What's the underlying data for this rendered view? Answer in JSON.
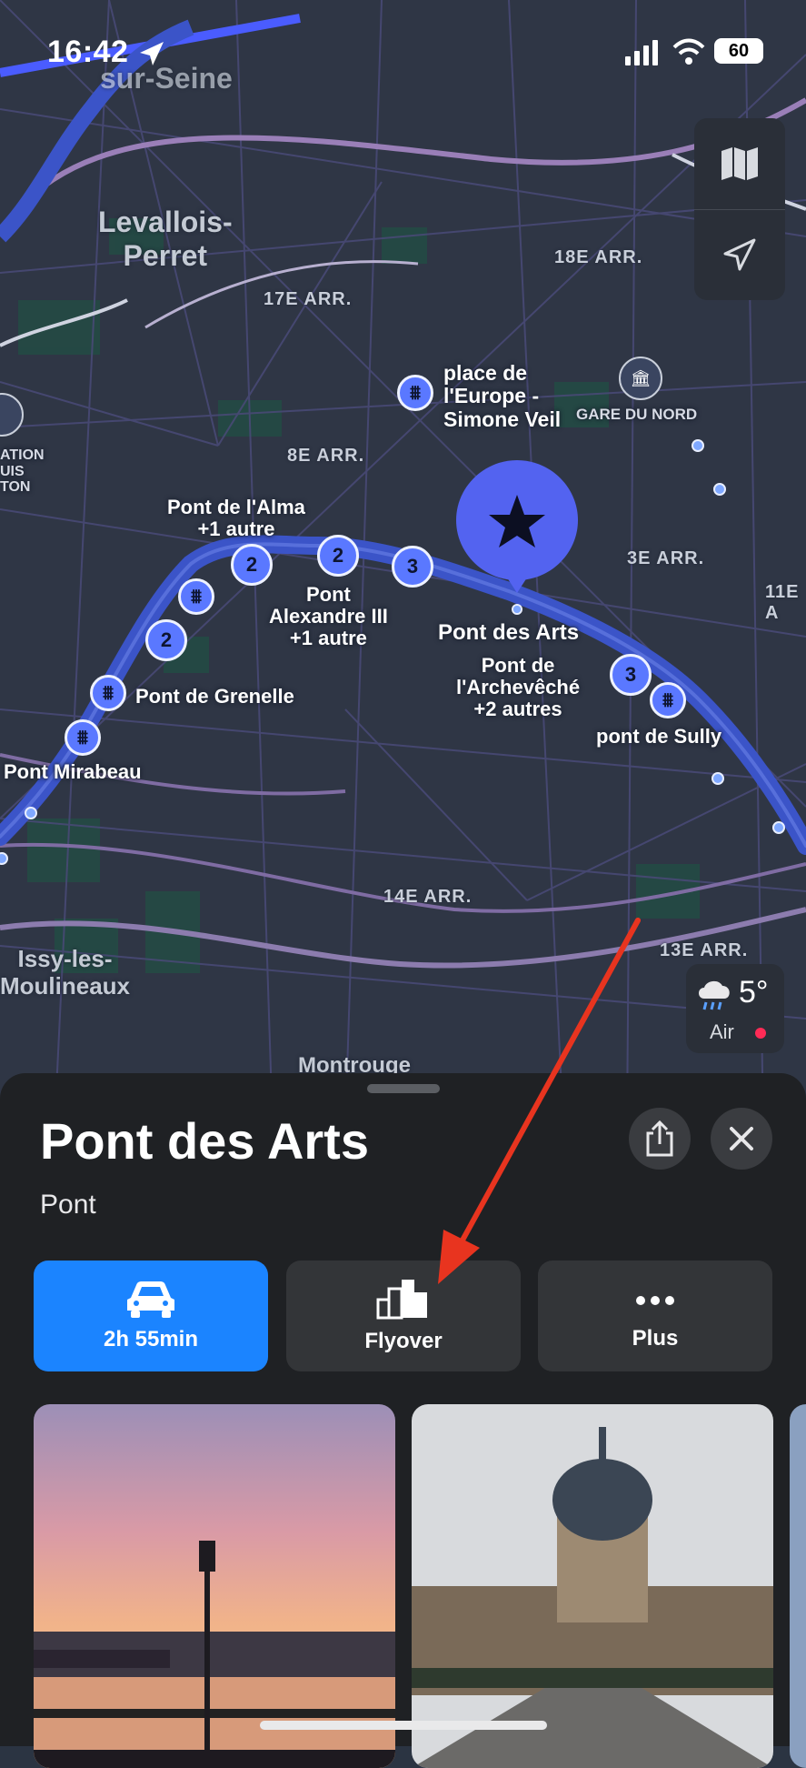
{
  "status_bar": {
    "time": "16:42",
    "battery": "60"
  },
  "map": {
    "cities": [
      {
        "id": "levallois",
        "text": "Levallois-\nPerret"
      },
      {
        "id": "sur-seine",
        "text": "sur-Seine"
      },
      {
        "id": "issy",
        "text": "Issy-les-\nMoulineaux"
      },
      {
        "id": "montrouge",
        "text": "Montrouge"
      }
    ],
    "districts": [
      "18E ARR.",
      "17E ARR.",
      "8E ARR.",
      "3E ARR.",
      "11E A",
      "14E ARR.",
      "13E ARR."
    ],
    "labels": {
      "alma": "Pont de l'Alma\n+1 autre",
      "alexandre": "Pont\nAlexandre III\n+1 autre",
      "arts": "Pont des Arts",
      "archeveche": "Pont de\nl'Archevêché\n+2 autres",
      "sully": "pont de Sully",
      "grenelle": "Pont de Grenelle",
      "mirabeau": "Pont Mirabeau",
      "europe": "place de\nl'Europe -\nSimone Veil",
      "gare_nord": "GARE DU NORD",
      "fondation": "ATION\nUIS\nTON"
    },
    "cluster_counts": {
      "c1": "2",
      "c2": "2",
      "c3": "3",
      "c4": "2",
      "c5": "3"
    }
  },
  "weather": {
    "temp": "5°",
    "air_label": "Air"
  },
  "sheet": {
    "title": "Pont des Arts",
    "subtitle": "Pont",
    "actions": [
      {
        "label": "2h 55min",
        "icon": "car-icon"
      },
      {
        "label": "Flyover",
        "icon": "buildings-icon"
      },
      {
        "label": "Plus",
        "icon": "more-icon"
      }
    ]
  },
  "colors": {
    "accent": "#1b84ff",
    "pin": "#5a78ff",
    "river": "#3b54c8",
    "annotation_arrow": "#e8341f"
  }
}
